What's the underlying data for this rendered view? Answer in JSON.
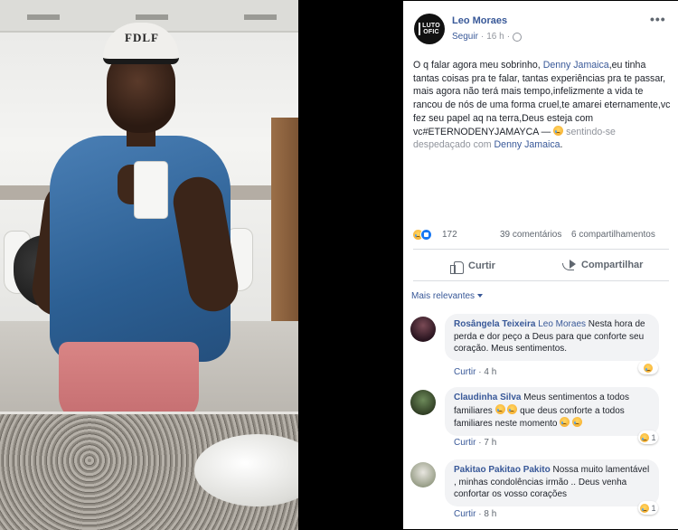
{
  "photo": {
    "cap_text": "FDLF"
  },
  "post": {
    "avatar_text_line1": "LUTO",
    "avatar_text_line2": "OFIC",
    "author": "Leo Moraes",
    "follow_label": "Seguir",
    "time": "16 h",
    "separator": "·",
    "more_label": "•••",
    "body_part1": "O q falar agora meu sobrinho, ",
    "body_tag1": "Denny Jamaica",
    "body_part2": ",eu tinha tantas coisas pra te falar, tantas experiências pra te passar, mais agora não terá mais tempo,infelizmente a vida te rancou de nós de uma forma cruel,te amarei eternamente,vc fez seu papel aq na terra,Deus esteja com vc#ETERNODENYJAMAYCA — ",
    "feeling_text": "sentindo-se despedaçado com",
    "body_tag2": "Denny Jamaica",
    "body_end": ".",
    "reaction_count": "172",
    "comments_count": "39 comentários",
    "shares_count": "6 compartilhamentos",
    "like_label": "Curtir",
    "share_label": "Compartilhar",
    "relevant_label": "Mais relevantes"
  },
  "comments": [
    {
      "name": "Rosângela Teixeira",
      "tag": "Leo Moraes",
      "text": " Nesta hora de perda e dor peço a Deus para que conforte seu coração. Meus sentimentos.",
      "reply_label": "Curtir",
      "time": "4 h",
      "reaction_count": ""
    },
    {
      "name": "Claudinha Silva",
      "text_a": " Meus sentimentos a todos familiares ",
      "text_b": " que deus conforte a todos familiares neste momento ",
      "reply_label": "Curtir",
      "time": "7 h",
      "reaction_count": "1"
    },
    {
      "name": "Pakitao Pakitao Pakito",
      "text": " Nossa muito lamentável , minhas condolências irmão .. Deus venha confortar os vosso corações",
      "reply_label": "Curtir",
      "time": "8 h",
      "reaction_count": "1"
    }
  ],
  "colors": {
    "link": "#385898",
    "meta": "#90949c",
    "like_blue": "#1877f2",
    "bubble": "#f2f3f5"
  }
}
